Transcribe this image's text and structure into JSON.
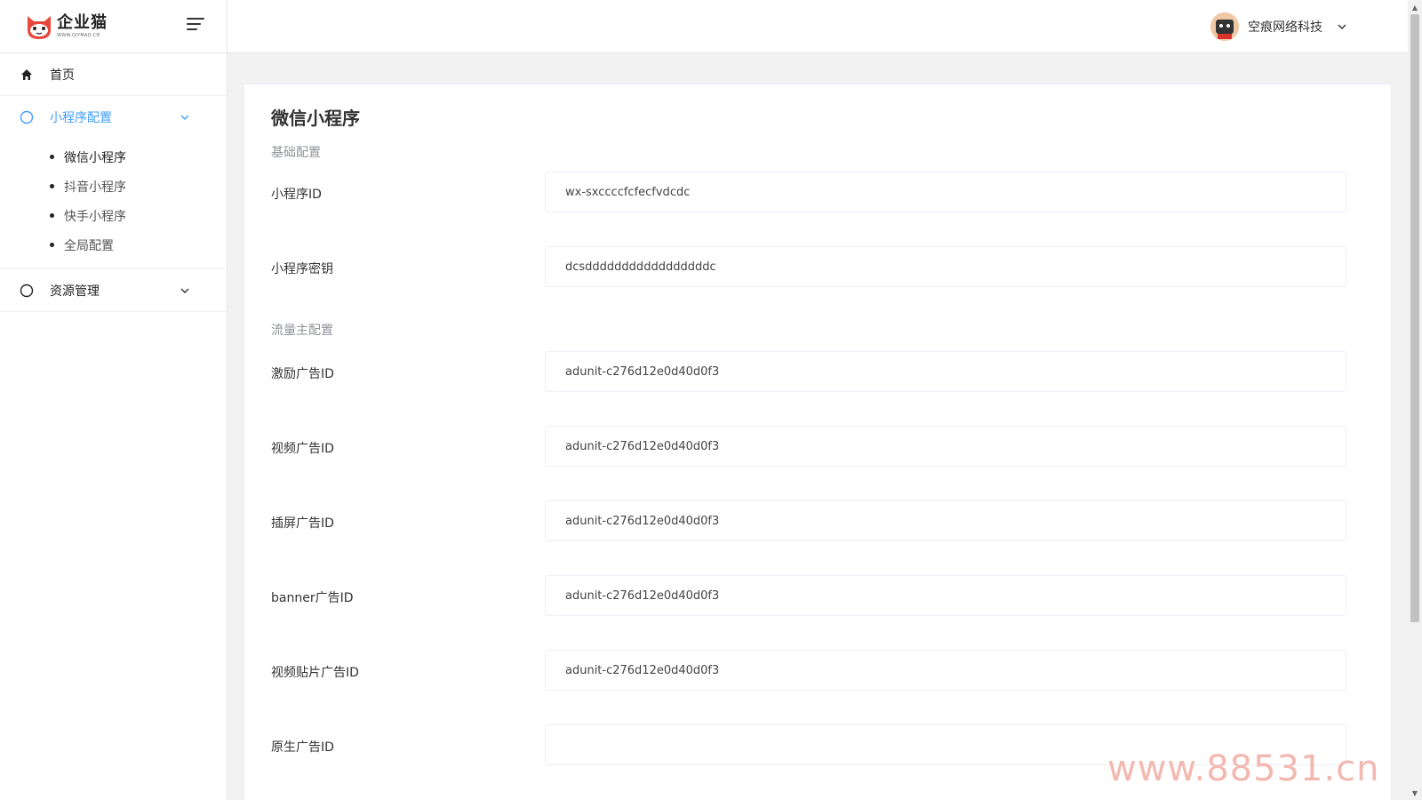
{
  "logo": {
    "title": "企业猫",
    "subtitle": "WWW.QIYMAO.CN"
  },
  "sidebar": {
    "items": [
      {
        "label": "首页"
      },
      {
        "label": "小程序配置",
        "sub": [
          "微信小程序",
          "抖音小程序",
          "快手小程序",
          "全局配置"
        ]
      },
      {
        "label": "资源管理"
      }
    ]
  },
  "header": {
    "user_name": "空痕网络科技"
  },
  "page": {
    "title": "微信小程序",
    "sections": [
      "基础配置",
      "流量主配置"
    ],
    "fields": [
      {
        "label": "小程序ID",
        "value": "wx-sxccccfcfecfvdcdc"
      },
      {
        "label": "小程序密钥",
        "value": "dcsdddddddddddddddddc"
      },
      {
        "label": "激励广告ID",
        "value": "adunit-c276d12e0d40d0f3"
      },
      {
        "label": "视频广告ID",
        "value": "adunit-c276d12e0d40d0f3"
      },
      {
        "label": "插屏广告ID",
        "value": "adunit-c276d12e0d40d0f3"
      },
      {
        "label": "banner广告ID",
        "value": "adunit-c276d12e0d40d0f3"
      },
      {
        "label": "视频贴片广告ID",
        "value": "adunit-c276d12e0d40d0f3"
      },
      {
        "label": "原生广告ID",
        "value": ""
      }
    ]
  },
  "watermark": "www.88531.cn",
  "colors": {
    "accent": "#409eff",
    "text": "#303133",
    "muted": "#909399"
  }
}
